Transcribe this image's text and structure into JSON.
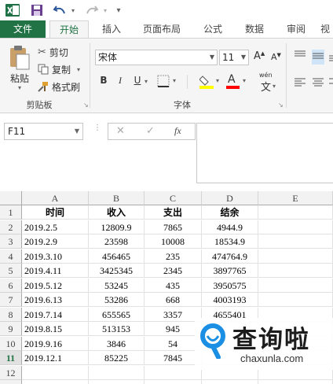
{
  "qat": {
    "app_icon": "excel-logo",
    "save_icon": "save-icon",
    "undo_icon": "undo-icon",
    "redo_icon": "redo-icon",
    "customize_icon": "qat-customize-icon"
  },
  "tabs": {
    "file": "文件",
    "items": [
      "开始",
      "插入",
      "页面布局",
      "公式",
      "数据",
      "审阅",
      "视"
    ]
  },
  "clipboard": {
    "paste": "粘贴",
    "cut": "剪切",
    "copy": "复制",
    "format_painter": "格式刷",
    "group_label": "剪贴板"
  },
  "font": {
    "name": "宋体",
    "size": "11",
    "bold": "B",
    "italic": "I",
    "underline": "U",
    "grow": "A",
    "shrink": "A",
    "phonetic": "wén",
    "group_label": "字体"
  },
  "colors": {
    "accent": "#217346",
    "fill_highlight": "#ffff00",
    "font_red": "#ff0000"
  },
  "formula_bar": {
    "name_box": "F11",
    "fx": "fx",
    "cancel": "✕",
    "enter": "✓"
  },
  "grid": {
    "columns": [
      "A",
      "B",
      "C",
      "D",
      "E"
    ],
    "row_numbers": [
      "1",
      "2",
      "3",
      "4",
      "5",
      "6",
      "7",
      "8",
      "9",
      "10",
      "11",
      "12",
      "13"
    ],
    "header": [
      "时间",
      "收入",
      "支出",
      "结余"
    ],
    "rows": [
      [
        "2019.2.5",
        "12809.9",
        "7865",
        "4944.9"
      ],
      [
        "2019.2.9",
        "23598",
        "10008",
        "18534.9"
      ],
      [
        "2019.3.10",
        "456465",
        "235",
        "474764.9"
      ],
      [
        "2019.4.11",
        "3425345",
        "2345",
        "3897765"
      ],
      [
        "2019.5.12",
        "53245",
        "435",
        "3950575"
      ],
      [
        "2019.6.13",
        "53286",
        "668",
        "4003193"
      ],
      [
        "2019.7.14",
        "655565",
        "3357",
        "4655401"
      ],
      [
        "2019.8.15",
        "513153",
        "945",
        ""
      ],
      [
        "2019.9.16",
        "3846",
        "54",
        ""
      ],
      [
        "2019.12.1",
        "85225",
        "7845",
        ""
      ]
    ]
  },
  "watermark": {
    "brand": "查询啦",
    "domain": "chaxunla.com"
  }
}
